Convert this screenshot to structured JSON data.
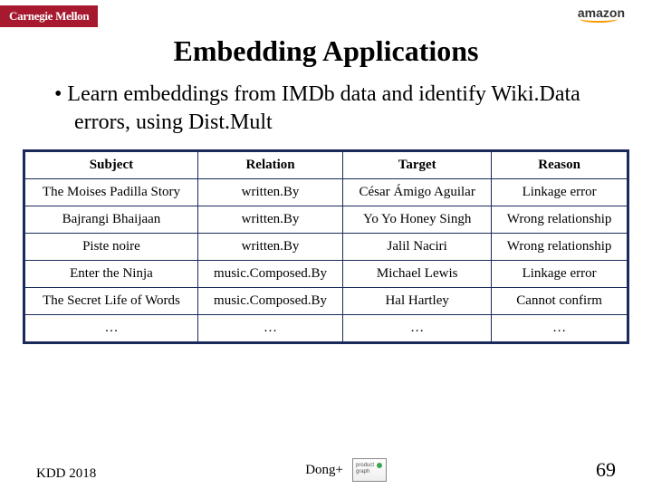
{
  "logos": {
    "cmu": "Carnegie Mellon",
    "amazon": "amazon"
  },
  "title": "Embedding Applications",
  "bullet": "Learn embeddings from IMDb data and identify Wiki.Data errors, using Dist.Mult",
  "table": {
    "headers": [
      "Subject",
      "Relation",
      "Target",
      "Reason"
    ],
    "rows": [
      [
        "The Moises Padilla Story",
        "written.By",
        "César Ámigo Aguilar",
        "Linkage error"
      ],
      [
        "Bajrangi Bhaijaan",
        "written.By",
        "Yo Yo Honey Singh",
        "Wrong relationship"
      ],
      [
        "Piste noire",
        "written.By",
        "Jalil Naciri",
        "Wrong relationship"
      ],
      [
        "Enter the Ninja",
        "music.Composed.By",
        "Michael Lewis",
        "Linkage error"
      ],
      [
        "The Secret Life of Words",
        "music.Composed.By",
        "Hal Hartley",
        "Cannot confirm"
      ],
      [
        "…",
        "…",
        "…",
        "…"
      ]
    ]
  },
  "footer": {
    "left": "KDD 2018",
    "center": "Dong+",
    "page": "69"
  }
}
